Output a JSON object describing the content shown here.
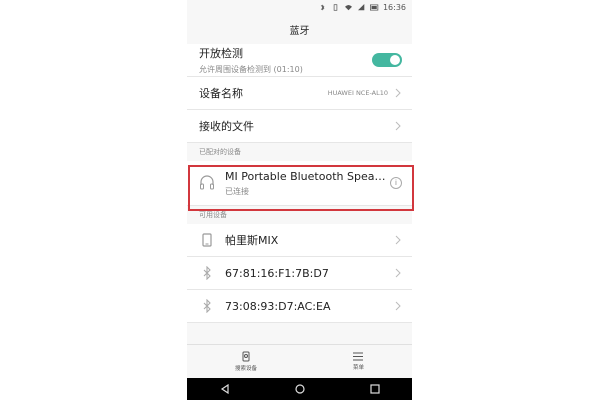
{
  "status_bar": {
    "time": "16:36"
  },
  "header": {
    "title": "蓝牙"
  },
  "settings": {
    "discoverable": {
      "label": "开放检测",
      "sublabel": "允许周围设备检测到 (01:10)",
      "enabled": true
    },
    "device_name": {
      "label": "设备名称",
      "value": "HUAWEI NCE-AL10"
    },
    "received_files": {
      "label": "接收的文件"
    }
  },
  "paired": {
    "section_title": "已配对的设备",
    "devices": [
      {
        "name": "MI Portable Bluetooth Speak...",
        "status": "已连接",
        "icon": "headset-icon"
      }
    ]
  },
  "available": {
    "section_title": "可用设备",
    "devices": [
      {
        "name": "帕里斯MIX",
        "icon": "phone-icon"
      },
      {
        "name": "67:81:16:F1:7B:D7",
        "icon": "bluetooth-icon"
      },
      {
        "name": "73:08:93:D7:AC:EA",
        "icon": "bluetooth-icon"
      }
    ]
  },
  "bottom_bar": {
    "search_label": "搜索设备",
    "menu_label": "菜单"
  },
  "colors": {
    "accent": "#44b7a0",
    "highlight": "#d2373d"
  }
}
